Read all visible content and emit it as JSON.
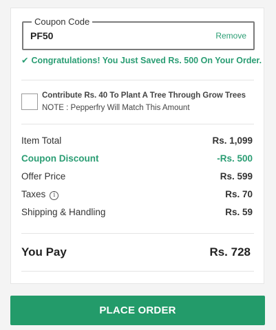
{
  "coupon": {
    "legend": "Coupon Code",
    "value": "PF50",
    "remove_label": "Remove",
    "success_icon": "✔",
    "success_message": "Congratulations! You Just Saved Rs. 500 On Your Order."
  },
  "contribution": {
    "checked": false,
    "title": "Contribute Rs. 40 To Plant A Tree Through Grow Trees",
    "note": "NOTE : Pepperfry Will Match This Amount"
  },
  "summary": {
    "item_total_label": "Item Total",
    "item_total_value": "Rs. 1,099",
    "coupon_discount_label": "Coupon Discount",
    "coupon_discount_value": "-Rs. 500",
    "offer_price_label": "Offer Price",
    "offer_price_value": "Rs. 599",
    "taxes_label": "Taxes",
    "taxes_info_icon": "i",
    "taxes_value": "Rs. 70",
    "shipping_label": "Shipping & Handling",
    "shipping_value": "Rs. 59",
    "you_pay_label": "You Pay",
    "you_pay_value": "Rs. 728"
  },
  "actions": {
    "place_order_label": "PLACE ORDER"
  },
  "colors": {
    "accent_green": "#239b6a",
    "success_text": "#2a9d73"
  }
}
